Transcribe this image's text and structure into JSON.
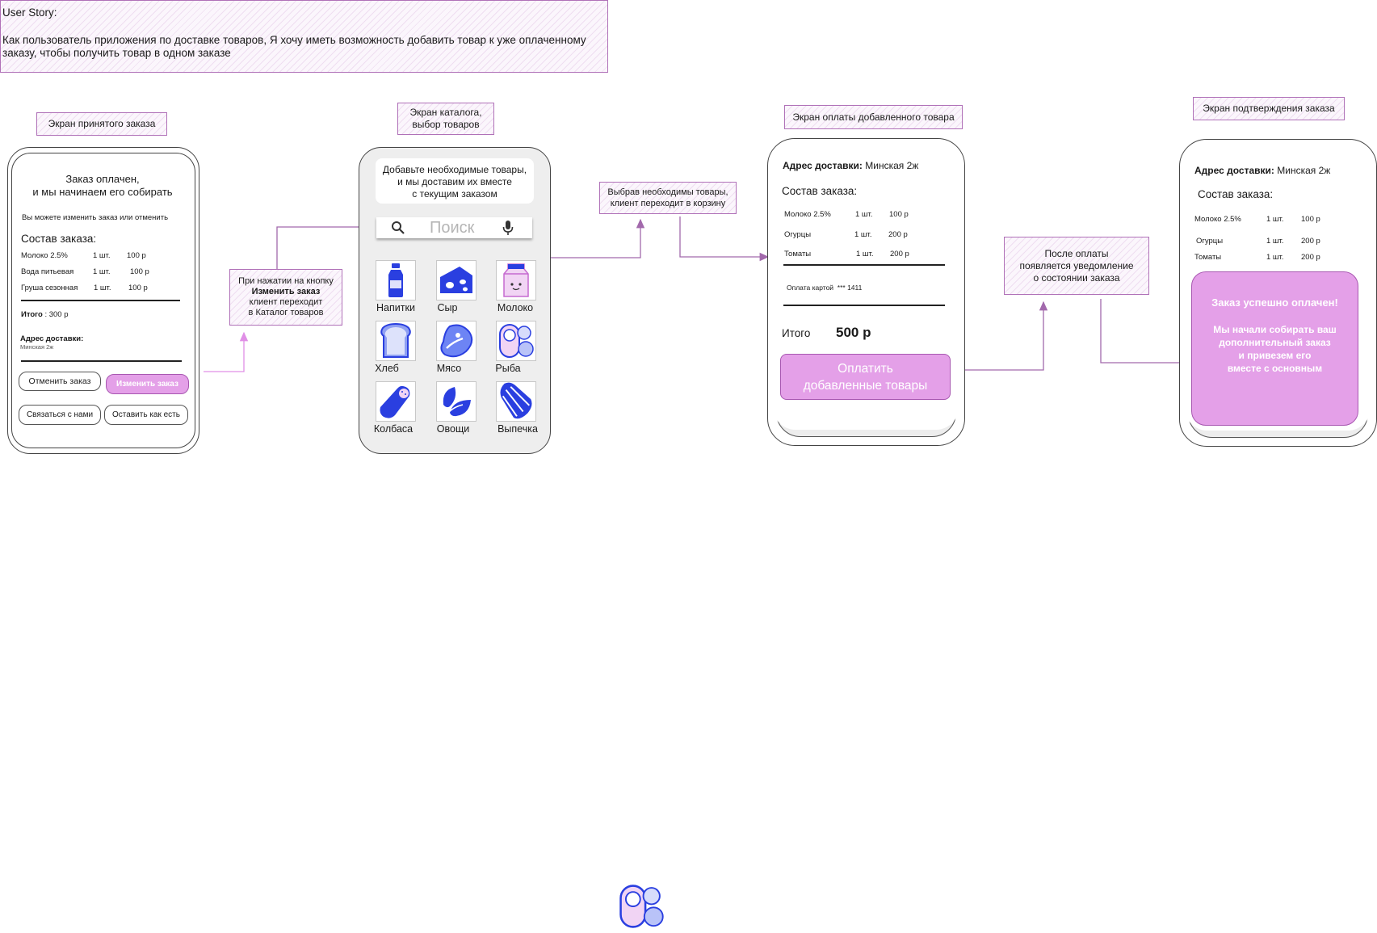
{
  "story": {
    "title": "User Story:",
    "text": "Как пользователь приложения по доставке товаров, Я хочу иметь возможность добавить товар к уже оплаченному заказу, чтобы получить товар в одном заказе"
  },
  "labels": {
    "accepted": "Экран принятого заказа",
    "catalog": "Экран каталога,\nвыбор товаров",
    "payment": "Экран оплаты добавленного товара",
    "confirm": "Экран подтверждения заказа"
  },
  "notes": {
    "change_pre": "При нажатии на кнопку",
    "change_bold": "Изменить заказ",
    "change_post": "клиент переходит\nв Каталог товаров",
    "cart": "Выбрав необходимы товары,\nклиент переходит в корзину",
    "after_pay": "После оплаты\nпоявляется уведомление\nо состоянии заказа"
  },
  "screen1": {
    "title": "Заказ оплачен,\nи мы начинаем его собирать",
    "subtitle": "Вы можете изменить заказ или отменить",
    "composition": "Состав заказа:",
    "items": [
      {
        "name": "Молоко 2.5%",
        "qty": "1 шт.",
        "price": "100 р"
      },
      {
        "name": "Вода питьевая",
        "qty": "1 шт.",
        "price": "100 р"
      },
      {
        "name": "Груша сезонная",
        "qty": "1 шт.",
        "price": "100 р"
      }
    ],
    "total_label": "Итого",
    "total_value": ": 300 р",
    "address_label": "Адрес доставки:",
    "address_value": "Минская 2ж",
    "btn_cancel": "Отменить заказ",
    "btn_change": "Изменить заказ",
    "btn_contact": "Связаться с нами",
    "btn_keep": "Оставить как есть"
  },
  "screen2": {
    "banner": "Добавьте необходимые товары,\nи мы доставим их вместе\nс текущим заказом",
    "search_placeholder": "Поиск",
    "categories": [
      "Напитки",
      "Сыр",
      "Молоко",
      "Хлеб",
      "Мясо",
      "Рыба",
      "Колбаса",
      "Овощи",
      "Выпечка"
    ]
  },
  "screen3": {
    "address_label": "Адрес доставки:",
    "address_value": "Минская 2ж",
    "composition": "Состав заказа:",
    "items": [
      {
        "name": "Молоко 2.5%",
        "qty": "1 шт.",
        "price": "100 р"
      },
      {
        "name": "Огурцы",
        "qty": "1 шт.",
        "price": "200 р"
      },
      {
        "name": "Томаты",
        "qty": "1 шт.",
        "price": "200 р"
      }
    ],
    "payment_method": "Оплата картой",
    "card_mask": "*** 1411",
    "total_label": "Итого",
    "total_value": "500 р",
    "pay_button": "Оплатить\nдобавленные товары"
  },
  "screen4": {
    "address_label": "Адрес доставки:",
    "address_value": "Минская 2ж",
    "composition": "Состав заказа:",
    "items": [
      {
        "name": "Молоко 2.5%",
        "qty": "1 шт.",
        "price": "100 р"
      },
      {
        "name": "Огурцы",
        "qty": "1 шт.",
        "price": "200 р"
      },
      {
        "name": "Томаты",
        "qty": "1 шт.",
        "price": "200 р"
      }
    ],
    "success_title": "Заказ успешно оплачен!",
    "success_text": "Мы начали собирать ваш\nдополнительный заказ\nи привезем его\nвместе с основным"
  },
  "colors": {
    "accent_pink": "#e4a0e8",
    "connector": "#a269ac",
    "icon_blue": "#2a3fe0"
  }
}
